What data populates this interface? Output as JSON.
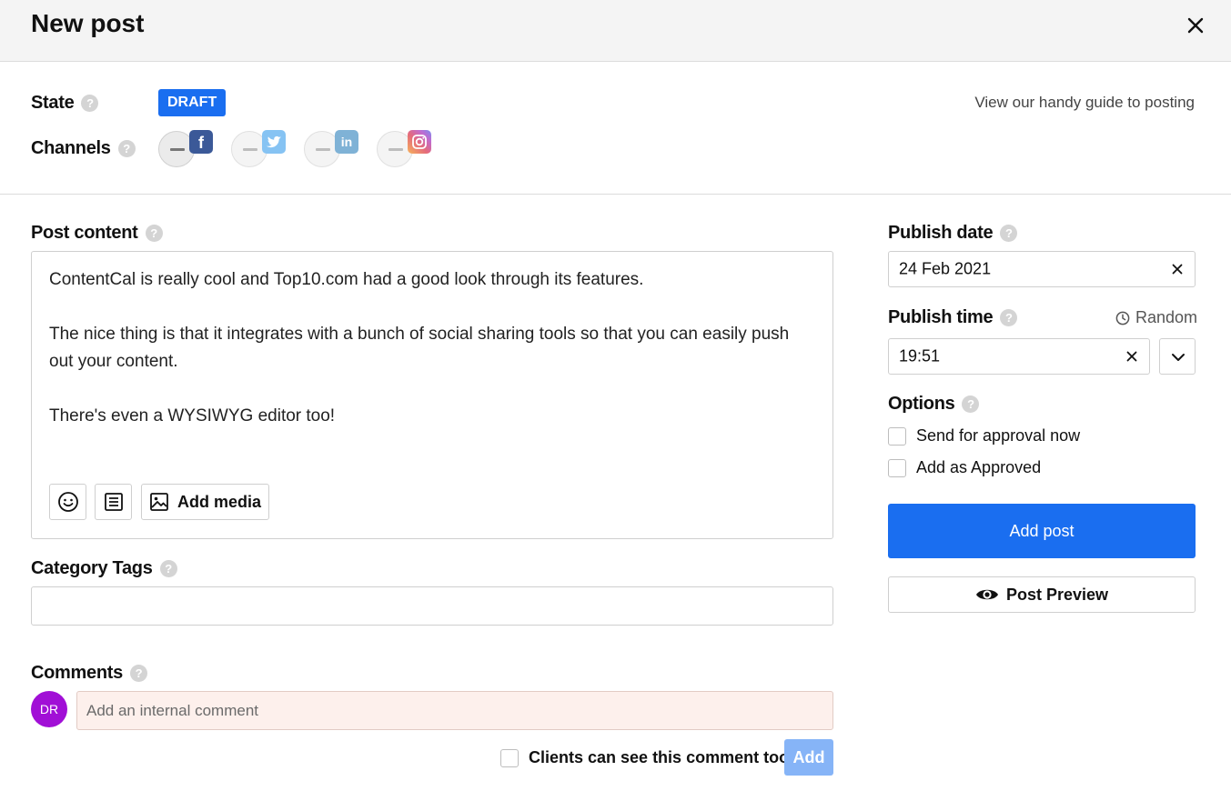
{
  "header": {
    "title": "New post",
    "close_icon": "close-icon"
  },
  "state": {
    "label": "State",
    "help": "?",
    "badge": "DRAFT",
    "badge_color": "#1a6ef0"
  },
  "guide_link": "View our handy guide to posting",
  "channels": {
    "label": "Channels",
    "help": "?",
    "items": [
      {
        "network": "facebook",
        "glyph": "f",
        "icon": "facebook-icon",
        "active": true
      },
      {
        "network": "twitter",
        "icon": "twitter-icon",
        "active": false
      },
      {
        "network": "linkedin",
        "glyph": "in",
        "icon": "linkedin-icon",
        "active": false
      },
      {
        "network": "instagram",
        "icon": "instagram-icon",
        "active": false
      }
    ]
  },
  "post_content": {
    "label": "Post content",
    "help": "?",
    "paragraphs": [
      "ContentCal is really cool and Top10.com had a good look through its features.",
      "The nice thing is that it integrates with a bunch of social sharing tools so that you can easily push out your content.",
      "There's even a WYSIWYG editor too!"
    ],
    "toolbar": {
      "emoji_icon": "emoji-icon",
      "notes_icon": "notes-icon",
      "add_media_label": "Add media"
    }
  },
  "category_tags": {
    "label": "Category Tags",
    "help": "?",
    "value": ""
  },
  "comments": {
    "label": "Comments",
    "help": "?",
    "avatar_initials": "DR",
    "avatar_color": "#a10fd6",
    "placeholder": "Add an internal comment",
    "clients_checkbox_label": "Clients can see this comment too",
    "add_label": "Add"
  },
  "publish_date": {
    "label": "Publish date",
    "help": "?",
    "value": "24 Feb 2021"
  },
  "publish_time": {
    "label": "Publish time",
    "help": "?",
    "value": "19:51",
    "random_label": "Random"
  },
  "options": {
    "label": "Options",
    "help": "?",
    "items": [
      {
        "label": "Send for approval now",
        "checked": false
      },
      {
        "label": "Add as Approved",
        "checked": false
      }
    ]
  },
  "actions": {
    "add_post_label": "Add post",
    "preview_label": "Post Preview",
    "primary_color": "#1a6ef0"
  }
}
